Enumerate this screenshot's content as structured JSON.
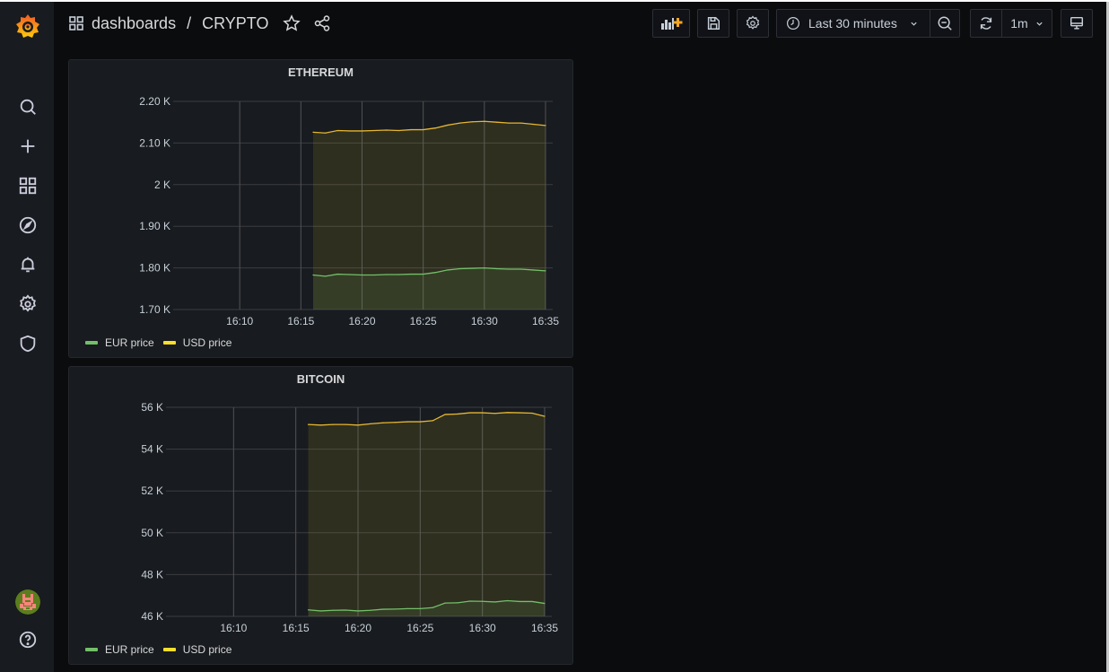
{
  "app": {
    "name": "Grafana",
    "colors": {
      "background": "#0b0c0e",
      "panel": "#181b1f",
      "eur": "#73bf69",
      "usd": "#fade2a",
      "usd_line": "#e5b631",
      "brand": "#f46800"
    }
  },
  "sidebar": {
    "items": [
      {
        "name": "search",
        "icon": "search-icon"
      },
      {
        "name": "create",
        "icon": "plus-icon"
      },
      {
        "name": "dashboards",
        "icon": "apps-icon"
      },
      {
        "name": "explore",
        "icon": "compass-icon"
      },
      {
        "name": "alerting",
        "icon": "bell-icon"
      },
      {
        "name": "configuration",
        "icon": "gear-icon"
      },
      {
        "name": "server-admin",
        "icon": "shield-icon"
      }
    ],
    "bottom": [
      {
        "name": "profile",
        "icon": "avatar"
      },
      {
        "name": "help",
        "icon": "question-circle-icon"
      }
    ]
  },
  "header": {
    "breadcrumb_root": "dashboards",
    "separator": "/",
    "title": "CRYPTO",
    "time_range": "Last 30 minutes",
    "refresh_interval": "1m"
  },
  "chart_data": [
    {
      "type": "area",
      "title": "ETHEREUM",
      "xlabel": "",
      "ylabel": "",
      "x_ticks": [
        "16:10",
        "16:15",
        "16:20",
        "16:25",
        "16:30",
        "16:35"
      ],
      "x_range_minutes": [
        "16:05",
        "16:35"
      ],
      "y_ticks": [
        "1.70 K",
        "1.80 K",
        "1.90 K",
        "2 K",
        "2.10 K",
        "2.20 K"
      ],
      "ylim": [
        1700,
        2200
      ],
      "grid": true,
      "legend": "bottom-left",
      "x": [
        "16:16",
        "16:17",
        "16:18",
        "16:19",
        "16:20",
        "16:21",
        "16:22",
        "16:23",
        "16:24",
        "16:25",
        "16:26",
        "16:27",
        "16:28",
        "16:29",
        "16:30",
        "16:31",
        "16:32",
        "16:33",
        "16:34",
        "16:35"
      ],
      "series": [
        {
          "name": "EUR price",
          "values": [
            1783,
            1780,
            1785,
            1784,
            1783,
            1783,
            1784,
            1784,
            1785,
            1785,
            1789,
            1795,
            1798,
            1799,
            1800,
            1798,
            1797,
            1797,
            1795,
            1793
          ]
        },
        {
          "name": "USD price",
          "values": [
            2126,
            2124,
            2130,
            2129,
            2129,
            2130,
            2131,
            2130,
            2132,
            2132,
            2136,
            2143,
            2148,
            2151,
            2152,
            2150,
            2148,
            2148,
            2145,
            2142
          ]
        }
      ]
    },
    {
      "type": "area",
      "title": "BITCOIN",
      "xlabel": "",
      "ylabel": "",
      "x_ticks": [
        "16:10",
        "16:15",
        "16:20",
        "16:25",
        "16:30",
        "16:35"
      ],
      "x_range_minutes": [
        "16:05",
        "16:35"
      ],
      "y_ticks": [
        "46 K",
        "48 K",
        "50 K",
        "52 K",
        "54 K",
        "56 K"
      ],
      "ylim": [
        46000,
        56000
      ],
      "grid": true,
      "legend": "bottom-left",
      "x": [
        "16:16",
        "16:17",
        "16:18",
        "16:19",
        "16:20",
        "16:21",
        "16:22",
        "16:23",
        "16:24",
        "16:25",
        "16:26",
        "16:27",
        "16:28",
        "16:29",
        "16:30",
        "16:31",
        "16:32",
        "16:33",
        "16:34",
        "16:35"
      ],
      "series": [
        {
          "name": "EUR price",
          "values": [
            46310,
            46260,
            46290,
            46300,
            46260,
            46290,
            46340,
            46350,
            46370,
            46370,
            46420,
            46640,
            46650,
            46730,
            46720,
            46690,
            46750,
            46710,
            46710,
            46620
          ]
        },
        {
          "name": "USD price",
          "values": [
            55180,
            55150,
            55180,
            55180,
            55150,
            55210,
            55260,
            55280,
            55310,
            55310,
            55360,
            55660,
            55680,
            55740,
            55740,
            55710,
            55750,
            55740,
            55720,
            55570
          ]
        }
      ]
    }
  ]
}
